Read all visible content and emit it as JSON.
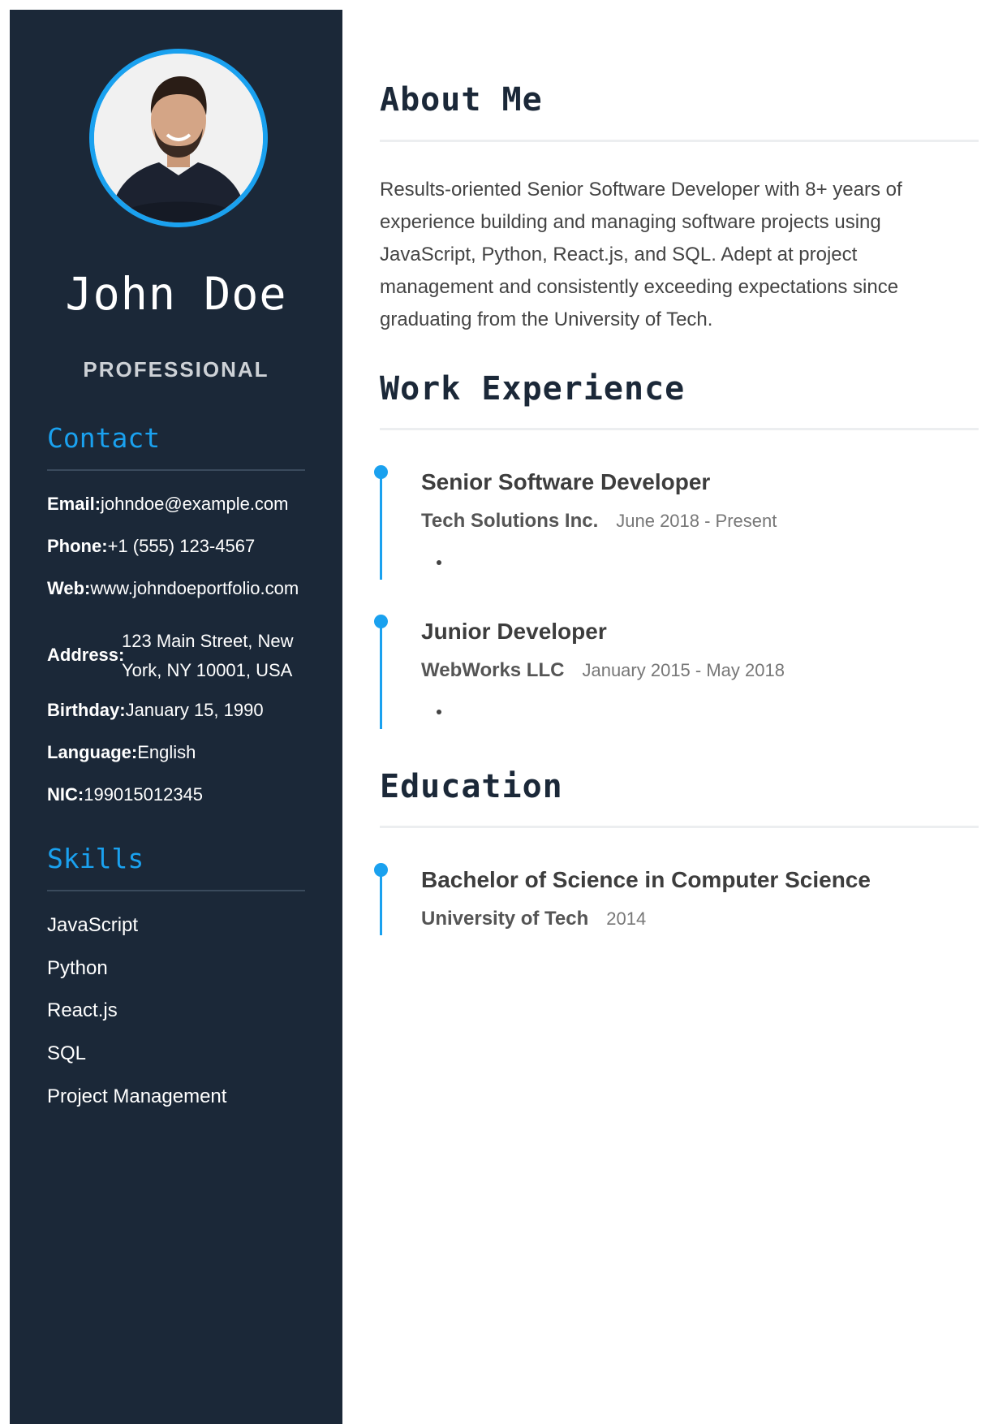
{
  "profile": {
    "name": "John Doe",
    "title": "PROFESSIONAL"
  },
  "contact": {
    "heading": "Contact",
    "email_label": "Email:",
    "email": "johndoe@example.com",
    "phone_label": "Phone:",
    "phone": "+1 (555) 123-4567",
    "web_label": "Web:",
    "web": "www.johndoeportfolio.com",
    "address_label": "Address:",
    "address": "123 Main Street, New York, NY 10001, USA",
    "birthday_label": "Birthday:",
    "birthday": "January 15, 1990",
    "language_label": "Language:",
    "language": "English",
    "nic_label": "NIC:",
    "nic": "199015012345"
  },
  "skills": {
    "heading": "Skills",
    "items": [
      "JavaScript",
      "Python",
      "React.js",
      "SQL",
      "Project Management"
    ]
  },
  "about": {
    "heading": "About Me",
    "text": "Results-oriented Senior Software Developer with 8+ years of experience building and managing software projects using JavaScript, Python, React.js, and SQL. Adept at project management and consistently exceeding expectations since graduating from the University of Tech."
  },
  "work": {
    "heading": "Work Experience",
    "jobs": [
      {
        "title": "Senior Software Developer",
        "company": "Tech Solutions Inc.",
        "dates": "June 2018 - Present"
      },
      {
        "title": "Junior Developer",
        "company": "WebWorks LLC",
        "dates": "January 2015 - May 2018"
      }
    ]
  },
  "education": {
    "heading": "Education",
    "items": [
      {
        "degree": "Bachelor of Science in Computer Science",
        "school": "University of Tech",
        "year": "2014"
      }
    ]
  },
  "colors": {
    "sidebar_bg": "#1b2838",
    "accent": "#1aa1ef",
    "heading_dark": "#1b2838"
  },
  "icons": {
    "profile_photo": "avatar-photo"
  }
}
